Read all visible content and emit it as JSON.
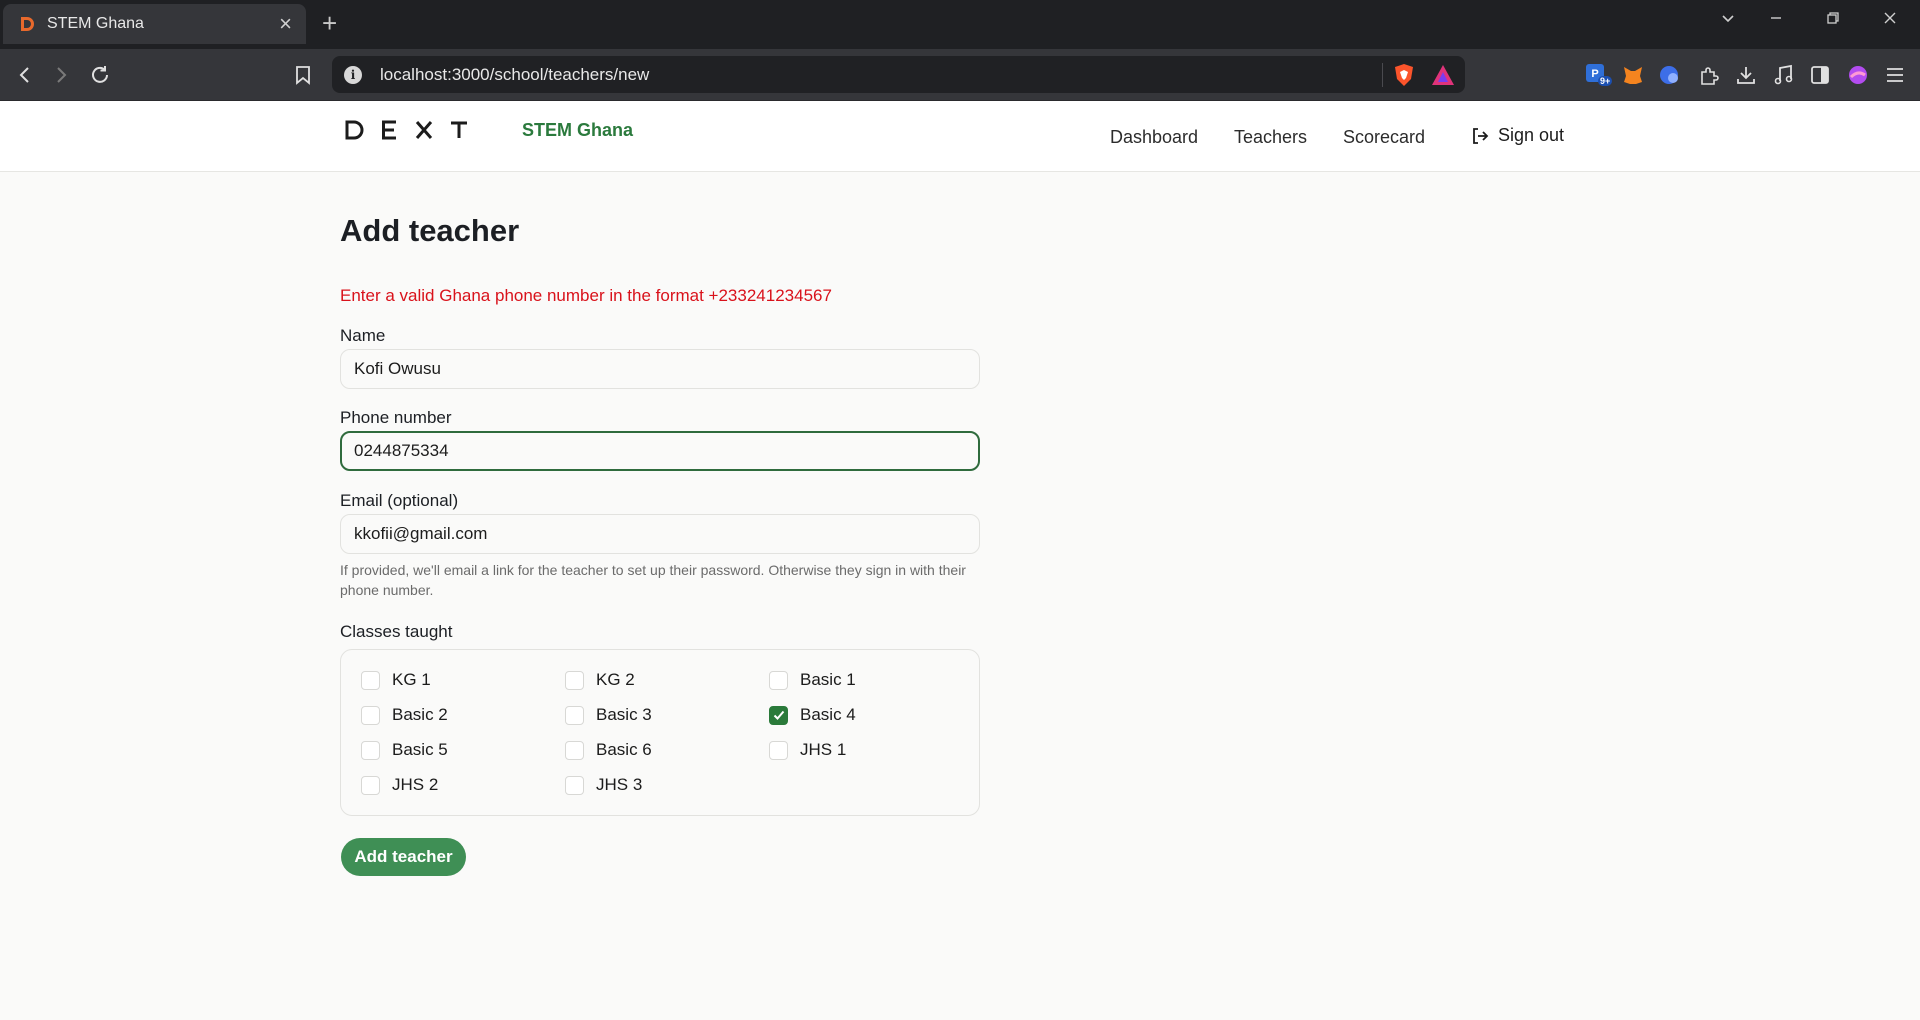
{
  "browser": {
    "tab_title": "STEM Ghana",
    "new_tab_symbol": "+",
    "url": "localhost:3000/school/teachers/new",
    "notification_badge": "9+"
  },
  "header": {
    "logo_letters": [
      "D",
      "E",
      "X",
      "T"
    ],
    "brand_name": "STEM Ghana",
    "nav": {
      "dashboard": "Dashboard",
      "teachers": "Teachers",
      "scorecard": "Scorecard"
    },
    "sign_out": "Sign out"
  },
  "form": {
    "title": "Add teacher",
    "error": "Enter a valid Ghana phone number in the format +233241234567",
    "name": {
      "label": "Name",
      "value": "Kofi Owusu"
    },
    "phone": {
      "label": "Phone number",
      "value": "0244875334"
    },
    "email": {
      "label": "Email (optional)",
      "value": "kkofii@gmail.com",
      "help": "If provided, we'll email a link for the teacher to set up their password. Otherwise they sign in with their phone number."
    },
    "classes": {
      "label": "Classes taught",
      "items": [
        {
          "label": "KG 1",
          "checked": false
        },
        {
          "label": "KG 2",
          "checked": false
        },
        {
          "label": "Basic 1",
          "checked": false
        },
        {
          "label": "Basic 2",
          "checked": false
        },
        {
          "label": "Basic 3",
          "checked": false
        },
        {
          "label": "Basic 4",
          "checked": true
        },
        {
          "label": "Basic 5",
          "checked": false
        },
        {
          "label": "Basic 6",
          "checked": false
        },
        {
          "label": "JHS 1",
          "checked": false
        },
        {
          "label": "JHS 2",
          "checked": false
        },
        {
          "label": "JHS 3",
          "checked": false
        }
      ]
    },
    "submit": "Add teacher"
  },
  "colors": {
    "brand_green": "#2b7a3d",
    "button_green": "#3f8f55",
    "error_red": "#d9121b",
    "focus_border": "#2f6b3d"
  }
}
